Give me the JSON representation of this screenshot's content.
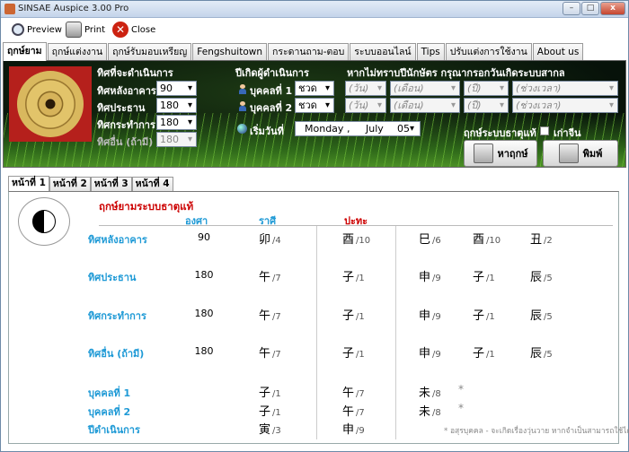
{
  "window": {
    "title": "SINSAE Auspice 3.00 Pro",
    "min_glyph": "–",
    "max_glyph": "□",
    "close_glyph": "x"
  },
  "toolbar": {
    "preview": "Preview",
    "print": "Print",
    "close": "Close"
  },
  "tabs": [
    "ฤกษ์ยาม",
    "ฤกษ์แต่งงาน",
    "ฤกษ์รับมอบเหรียญ",
    "Fengshuitown",
    "กระดานถาม-ตอบ",
    "ระบบออนไลน์",
    "Tips",
    "ปรับแต่งการใช้งาน",
    "About us"
  ],
  "form": {
    "direction_header": "ทิศที่จะดำเนินการ",
    "building_dir_label": "ทิศหลังอาคาร",
    "building_dir_value": "90",
    "chief_dir_label": "ทิศประธาน",
    "chief_dir_value": "180",
    "action_dir_label": "ทิศกระทำการ",
    "action_dir_value": "180",
    "other_dir_label": "ทิศอื่น (ถ้ามี)",
    "other_dir_value": "180",
    "birth_year_header": "ปีเกิดผู้ดำเนินการ",
    "person1_label": "บุคคลที่ 1",
    "person1_year": "ชวด",
    "person2_label": "บุคคลที่ 2",
    "person2_year": "ชวด",
    "unknown_header": "หากไม่ทราบปีนักษัตร กรุณากรอกวันเกิดระบบสากล",
    "day_placeholder": "(วัน)",
    "month_placeholder": "(เดือน)",
    "year_placeholder": "(ปี)",
    "time_placeholder": "(ช่วงเวลา)",
    "start_date_label": "เริ่มวันที่",
    "start_weekday": "Monday",
    "start_sep": ",",
    "start_month": "July",
    "start_day": "05",
    "true_system_label": "ฤกษ์ระบบธาตุแท้",
    "old_chinese_label": "เก่าจีน",
    "find_button": "หาฤกษ์",
    "print_button": "พิมพ์"
  },
  "page_tabs": [
    "หน้าที่ 1",
    "หน้าที่ 2",
    "หน้าที่ 3",
    "หน้าที่ 4"
  ],
  "content": {
    "title": "ฤกษ์ยามระบบธาตุแท้",
    "col_degree": "องศา",
    "col_zodiac": "ราศี",
    "col_clash": "ปะทะ",
    "rows": [
      {
        "label": "ทิศหลังอาคาร",
        "degree": "90",
        "rasi": "卯",
        "rasi_n": "/4",
        "clash": "酉",
        "clash_n": "/10",
        "e1": "巳",
        "e1_n": "/6",
        "e2": "酉",
        "e2_n": "/10",
        "e3": "丑",
        "e3_n": "/2"
      },
      {
        "label": "ทิศประธาน",
        "degree": "180",
        "rasi": "午",
        "rasi_n": "/7",
        "clash": "子",
        "clash_n": "/1",
        "e1": "申",
        "e1_n": "/9",
        "e2": "子",
        "e2_n": "/1",
        "e3": "辰",
        "e3_n": "/5"
      },
      {
        "label": "ทิศกระทำการ",
        "degree": "180",
        "rasi": "午",
        "rasi_n": "/7",
        "clash": "子",
        "clash_n": "/1",
        "e1": "申",
        "e1_n": "/9",
        "e2": "子",
        "e2_n": "/1",
        "e3": "辰",
        "e3_n": "/5"
      },
      {
        "label": "ทิศอื่น (ถ้ามี)",
        "degree": "180",
        "rasi": "午",
        "rasi_n": "/7",
        "clash": "子",
        "clash_n": "/1",
        "e1": "申",
        "e1_n": "/9",
        "e2": "子",
        "e2_n": "/1",
        "e3": "辰",
        "e3_n": "/5"
      },
      {
        "label": "บุคคลที่ 1",
        "rasi": "子",
        "rasi_n": "/1",
        "clash": "午",
        "clash_n": "/7",
        "e1": "未",
        "e1_n": "/8",
        "star": "*"
      },
      {
        "label": "บุคคลที่ 2",
        "rasi": "子",
        "rasi_n": "/1",
        "clash": "午",
        "clash_n": "/7",
        "e1": "未",
        "e1_n": "/8",
        "star": "*"
      },
      {
        "label": "ปีดำเนินการ",
        "rasi": "寅",
        "rasi_n": "/3",
        "clash": "申",
        "clash_n": "/9"
      }
    ],
    "note": "* อสุรบุคคล - จะเกิดเรื่องวุ่นวาย หากจำเป็นสามารถใช้ได้"
  },
  "colors": {
    "accent_blue": "#1f9ad6",
    "accent_red": "#cc0000",
    "panel_bg": "#07120a"
  }
}
